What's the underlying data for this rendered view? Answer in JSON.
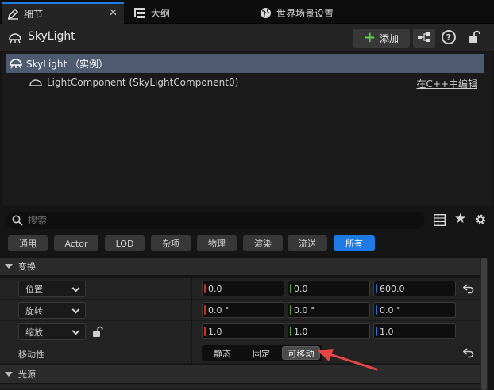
{
  "tabs": {
    "details": "细节",
    "outliner": "大纲",
    "world_settings": "世界场景设置"
  },
  "header": {
    "title": "SkyLight",
    "add_label": "添加"
  },
  "tree": {
    "root_label": "SkyLight （实例）",
    "component_label": "LightComponent (SkyLightComponent0)",
    "edit_link": "在C++中编辑"
  },
  "search": {
    "placeholder": "搜索"
  },
  "filters": [
    "通用",
    "Actor",
    "LOD",
    "杂项",
    "物理",
    "渲染",
    "流送",
    "所有"
  ],
  "sections": {
    "transform": "变换",
    "light": "光源"
  },
  "transform": {
    "location": {
      "label": "位置",
      "x": "0.0",
      "y": "0.0",
      "z": "600.0"
    },
    "rotation": {
      "label": "旋转",
      "x": "0.0 °",
      "y": "0.0 °",
      "z": "0.0 °"
    },
    "scale": {
      "label": "缩放",
      "x": "1.0",
      "y": "1.0",
      "z": "1.0"
    },
    "mobility": {
      "label": "移动性",
      "options": [
        "静态",
        "固定",
        "可移动"
      ],
      "selected": "可移动"
    }
  },
  "colors": {
    "accent": "#1f7ae6",
    "axis_x": "#c8341e",
    "axis_y": "#5aa531",
    "axis_z": "#2f6dd6",
    "annotation_arrow": "#e84545"
  }
}
